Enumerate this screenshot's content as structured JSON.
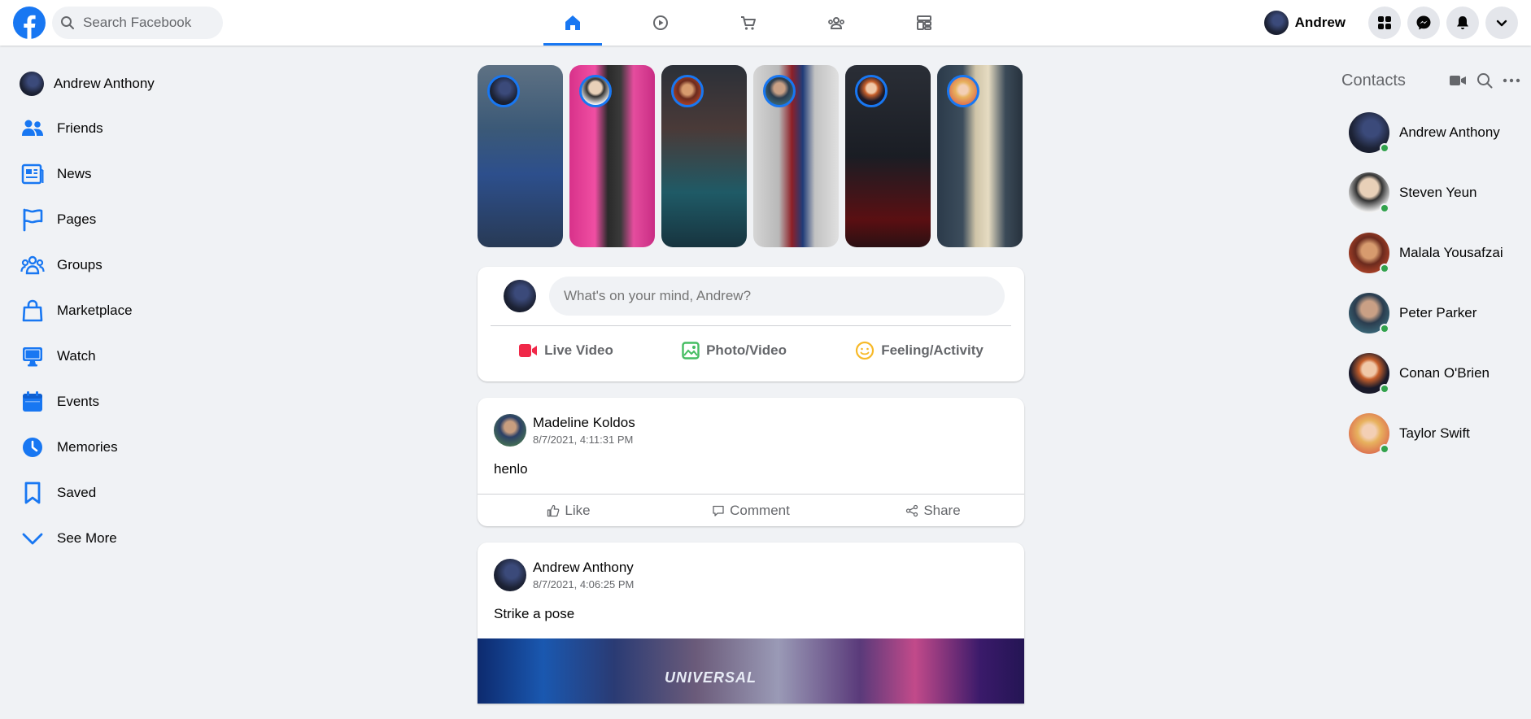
{
  "header": {
    "search_placeholder": "Search Facebook",
    "nav_tabs": [
      "home",
      "watch",
      "marketplace",
      "groups",
      "gaming"
    ],
    "user_name": "Andrew"
  },
  "sidebar": {
    "profile_name": "Andrew Anthony",
    "items": [
      {
        "label": "Friends",
        "icon": "friends-icon"
      },
      {
        "label": "News",
        "icon": "news-icon"
      },
      {
        "label": "Pages",
        "icon": "flag-icon"
      },
      {
        "label": "Groups",
        "icon": "groups-icon"
      },
      {
        "label": "Marketplace",
        "icon": "shopping-bag-icon"
      },
      {
        "label": "Watch",
        "icon": "monitor-icon"
      },
      {
        "label": "Events",
        "icon": "calendar-icon"
      },
      {
        "label": "Memories",
        "icon": "clock-icon"
      },
      {
        "label": "Saved",
        "icon": "bookmark-icon"
      },
      {
        "label": "See More",
        "icon": "chevron-down-icon"
      }
    ]
  },
  "composer": {
    "placeholder": "What's on your mind, Andrew?",
    "actions": [
      "Live Video",
      "Photo/Video",
      "Feeling/Activity"
    ]
  },
  "posts": [
    {
      "author": "Madeline Koldos",
      "time": "8/7/2021, 4:11:31 PM",
      "text": "henlo",
      "actions": [
        "Like",
        "Comment",
        "Share"
      ]
    },
    {
      "author": "Andrew Anthony",
      "time": "8/7/2021, 4:06:25 PM",
      "text": "Strike a pose",
      "image_caption": "UNIVERSAL"
    }
  ],
  "contacts": {
    "title": "Contacts",
    "items": [
      "Andrew Anthony",
      "Steven Yeun",
      "Malala Yousafzai",
      "Peter Parker",
      "Conan O'Brien",
      "Taylor Swift"
    ]
  },
  "colors": {
    "brand": "#1877f2",
    "online": "#31a24c",
    "live": "#f02849",
    "photo": "#45bd62",
    "feeling": "#f7b928"
  }
}
